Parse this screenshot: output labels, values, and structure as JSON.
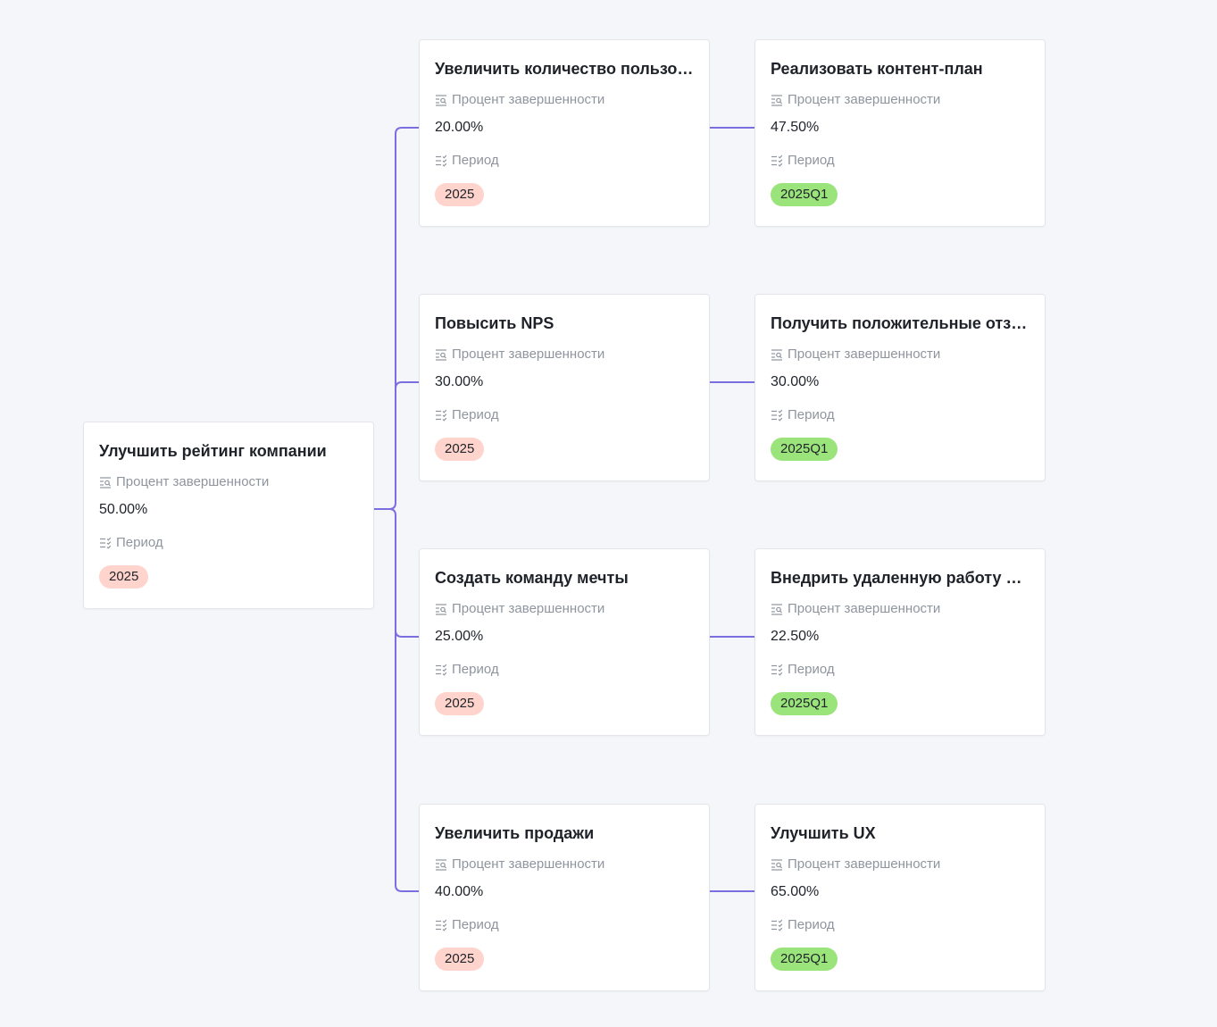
{
  "labels": {
    "percent": "Процент завершенности",
    "period": "Период"
  },
  "colors": {
    "connector": "#7b6ee0",
    "tag_year": "#ffd4cc",
    "tag_quarter": "#9be47c"
  },
  "nodes": {
    "root": {
      "title": "Улучшить рейтинг компании",
      "percent": "50.00%",
      "period": "2025"
    },
    "l1": [
      {
        "title": "Увеличить количество пользователей",
        "percent": "20.00%",
        "period": "2025"
      },
      {
        "title": "Повысить NPS",
        "percent": "30.00%",
        "period": "2025"
      },
      {
        "title": "Создать команду мечты",
        "percent": "25.00%",
        "period": "2025"
      },
      {
        "title": "Увеличить продажи",
        "percent": "40.00%",
        "period": "2025"
      }
    ],
    "l2": [
      {
        "title": "Реализовать контент-план",
        "percent": "47.50%",
        "period": "2025Q1"
      },
      {
        "title": "Получить положительные отзывы",
        "percent": "30.00%",
        "period": "2025Q1"
      },
      {
        "title": "Внедрить удаленную работу для сотрудников",
        "percent": "22.50%",
        "period": "2025Q1"
      },
      {
        "title": "Улучшить UX",
        "percent": "65.00%",
        "period": "2025Q1"
      }
    ]
  }
}
